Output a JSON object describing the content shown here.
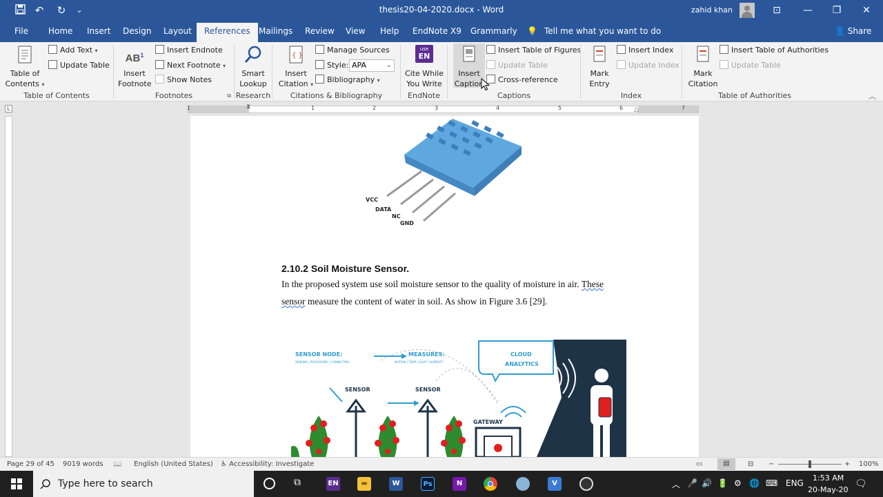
{
  "window": {
    "title": "thesis20-04-2020.docx  -  Word",
    "user": "zahid khan",
    "minimize": "—",
    "restore": "❐",
    "close": "✕",
    "ribbon_display": "⊡",
    "quick_access": {
      "save": "💾",
      "undo": "↶",
      "redo": "↻",
      "customize": "⌄"
    }
  },
  "tabs": [
    "File",
    "Home",
    "Insert",
    "Design",
    "Layout",
    "References",
    "Mailings",
    "Review",
    "View",
    "Help",
    "EndNote X9",
    "Grammarly"
  ],
  "tell_me": "Tell me what you want to do",
  "share": "Share",
  "ribbon": {
    "toc": {
      "label_1": "Table of",
      "label_2": "Contents",
      "add_text": "Add Text",
      "update_table": "Update Table",
      "group": "Table of Contents"
    },
    "footnotes": {
      "insert_1": "Insert",
      "insert_2": "Footnote",
      "insert_endnote": "Insert Endnote",
      "next_footnote": "Next Footnote",
      "show_notes": "Show Notes",
      "group": "Footnotes"
    },
    "research": {
      "smart_1": "Smart",
      "smart_2": "Lookup",
      "group": "Research"
    },
    "citations": {
      "insert_1": "Insert",
      "insert_2": "Citation",
      "manage_sources": "Manage Sources",
      "style_label": "Style:",
      "style_value": "APA",
      "bibliography": "Bibliography",
      "group": "Citations & Bibliography"
    },
    "endnote": {
      "cite_1": "Cite While",
      "cite_2": "You Write",
      "icon_text_1": "use",
      "icon_text_2": "EN",
      "group": "EndNote"
    },
    "captions": {
      "insert_1": "Insert",
      "insert_2": "Caption",
      "insert_tof": "Insert Table of Figures",
      "update_table": "Update Table",
      "cross_reference": "Cross-reference",
      "group": "Captions"
    },
    "index": {
      "mark_1": "Mark",
      "mark_2": "Entry",
      "insert_index": "Insert Index",
      "update_index": "Update Index",
      "group": "Index"
    },
    "toa": {
      "mark_1": "Mark",
      "mark_2": "Citation",
      "insert_toa": "Insert Table of Authorities",
      "update_table": "Update Table",
      "group": "Table of Authorities"
    }
  },
  "ruler_numbers": [
    "1",
    "1",
    "2",
    "3",
    "4",
    "5",
    "6",
    "7"
  ],
  "document": {
    "sensor_pins": [
      "VCC",
      "DATA",
      "NC",
      "GND"
    ],
    "heading": "2.10.2 Soil Moisture Sensor.",
    "para_line1_a": "In the proposed system use soil moisture sensor to the quality of moisture in air. ",
    "para_line1_b": "These",
    "para_line2_a": "sensor",
    "para_line2_b": " measure the content of water in soil. As show in Figure 3.6 [29].",
    "figure": {
      "sensor_node": "SENSOR NODE:",
      "sensor_node_sub": "SENSING | PROCESSING | CONNECTING",
      "measures": "MEASURES:",
      "measures_sub": "MOTION | TEMP | LIGHT | HUMIDITY",
      "sensor": "SENSOR",
      "cloud_1": "CLOUD",
      "cloud_2": "ANALYTICS",
      "gateway": "GATEWAY"
    }
  },
  "status": {
    "page": "Page 29 of 45",
    "words": "9019 words",
    "language": "English (United States)",
    "accessibility": "Accessibility: Investigate",
    "zoom": "100%"
  },
  "taskbar": {
    "search_placeholder": "Type here to search",
    "apps": [
      "EN",
      "W",
      "Ps",
      "N"
    ],
    "lang": "ENG",
    "time": "1:53 AM",
    "date": "20-May-20"
  },
  "colors": {
    "word_blue": "#2b579a",
    "ribbon_bg": "#f3f3f3",
    "sensor_blue": "#5fa8df",
    "figure_dark": "#1f3347",
    "tomato_red": "#e02020"
  }
}
